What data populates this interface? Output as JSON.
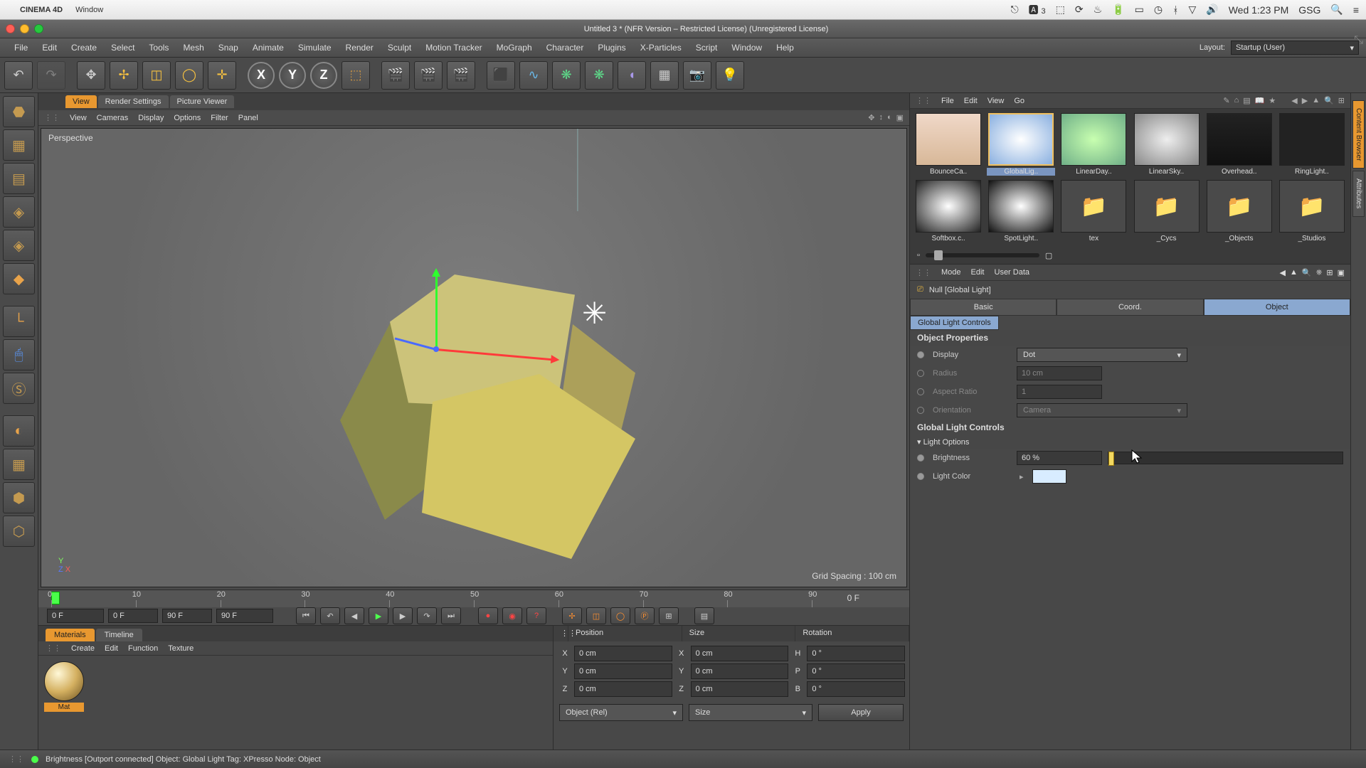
{
  "mac": {
    "app": "CINEMA 4D",
    "menu": "Window",
    "clock": "Wed 1:23 PM",
    "user": "GSG",
    "badge": "3"
  },
  "window": {
    "title": "Untitled 3 * (NFR Version – Restricted License) (Unregistered License)"
  },
  "app_menu": [
    "File",
    "Edit",
    "Create",
    "Select",
    "Tools",
    "Mesh",
    "Snap",
    "Animate",
    "Simulate",
    "Render",
    "Sculpt",
    "Motion Tracker",
    "MoGraph",
    "Character",
    "Plugins",
    "X-Particles",
    "Script",
    "Window",
    "Help"
  ],
  "layout": {
    "label": "Layout:",
    "value": "Startup (User)"
  },
  "axes": [
    "X",
    "Y",
    "Z"
  ],
  "view": {
    "tabs": [
      "View",
      "Render Settings",
      "Picture Viewer"
    ],
    "menu": [
      "View",
      "Cameras",
      "Display",
      "Options",
      "Filter",
      "Panel"
    ],
    "label": "Perspective",
    "grid": "Grid Spacing : 100 cm"
  },
  "timeline": {
    "ticks": [
      "0",
      "10",
      "20",
      "30",
      "40",
      "50",
      "60",
      "70",
      "80",
      "90"
    ],
    "end": "0 F",
    "start_field": "0 F",
    "range_a": "0 F",
    "range_b": "90 F",
    "end_field": "90 F"
  },
  "materials": {
    "tabs": [
      "Materials",
      "Timeline"
    ],
    "menu": [
      "Create",
      "Edit",
      "Function",
      "Texture"
    ],
    "item": "Mat"
  },
  "coords": {
    "headers": [
      "Position",
      "Size",
      "Rotation"
    ],
    "rows": [
      {
        "a": "X",
        "av": "0 cm",
        "b": "X",
        "bv": "0 cm",
        "c": "H",
        "cv": "0 °"
      },
      {
        "a": "Y",
        "av": "0 cm",
        "b": "Y",
        "bv": "0 cm",
        "c": "P",
        "cv": "0 °"
      },
      {
        "a": "Z",
        "av": "0 cm",
        "b": "Z",
        "bv": "0 cm",
        "c": "B",
        "cv": "0 °"
      }
    ],
    "sel1": "Object (Rel)",
    "sel2": "Size",
    "apply": "Apply"
  },
  "browser": {
    "menu": [
      "File",
      "Edit",
      "View",
      "Go"
    ],
    "items": [
      {
        "name": "BounceCa..",
        "icon": "◐"
      },
      {
        "name": "GlobalLig..",
        "icon": "◉",
        "sel": true
      },
      {
        "name": "LinearDay..",
        "icon": "◉"
      },
      {
        "name": "LinearSky..",
        "icon": "●"
      },
      {
        "name": "Overhead..",
        "icon": "▭"
      },
      {
        "name": "RingLight..",
        "icon": "◌"
      },
      {
        "name": "Softbox.c..",
        "icon": "◯"
      },
      {
        "name": "SpotLight..",
        "icon": "●"
      },
      {
        "name": "tex",
        "icon": "🗀"
      },
      {
        "name": "_Cycs",
        "icon": "🗀"
      },
      {
        "name": "_Objects",
        "icon": "🗀"
      },
      {
        "name": "_Studios",
        "icon": "🗀"
      }
    ]
  },
  "attr": {
    "menu": [
      "Mode",
      "Edit",
      "User Data"
    ],
    "object": "Null [Global Light]",
    "tabs": [
      "Basic",
      "Coord.",
      "Object"
    ],
    "active_tab": "Object",
    "subtab": "Global Light Controls",
    "sec_props": "Object Properties",
    "display_k": "Display",
    "display_v": "Dot",
    "radius_k": "Radius",
    "radius_v": "10 cm",
    "aspect_k": "Aspect Ratio",
    "aspect_v": "1",
    "orient_k": "Orientation",
    "orient_v": "Camera",
    "sec_glc": "Global Light Controls",
    "lightopts": "Light Options",
    "bright_k": "Brightness",
    "bright_v": "60 %",
    "lcolor_k": "Light Color"
  },
  "status": "Brightness [Outport connected] Object: Global Light  Tag: XPresso  Node:  Object",
  "vtabs": [
    "Content Browser",
    "Attributes"
  ]
}
